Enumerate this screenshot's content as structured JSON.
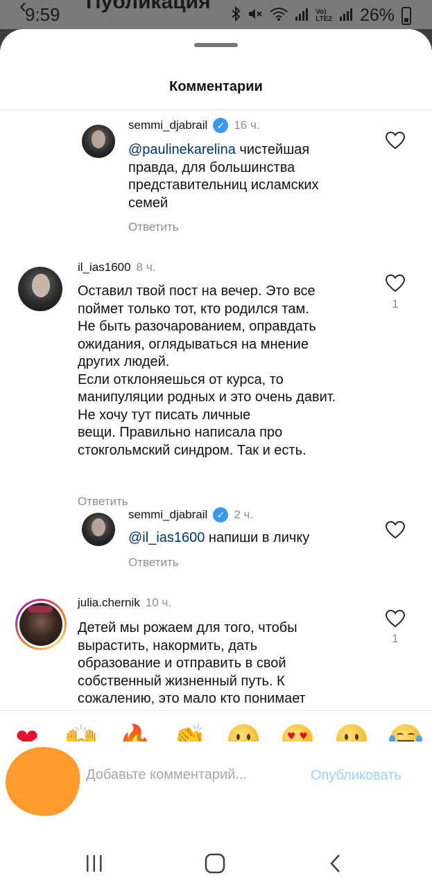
{
  "status_bar": {
    "time": "9:59",
    "title": "Публикация",
    "battery": "26%",
    "icons": [
      "bluetooth-icon",
      "mute-icon",
      "wifi-icon",
      "signal-icon",
      "volte-icon",
      "signal-icon",
      "battery-icon"
    ],
    "volte_label": "Vo)\nLTE2"
  },
  "sheet": {
    "title": "Комментарии"
  },
  "comments": [
    {
      "username": "semmi_djabrail",
      "verified": true,
      "time": "16 ч.",
      "mention": "@paulinekarelina",
      "text": " чистейшая\nправда, для большинства\nпредставительниц  исламских\nсемей",
      "reply": "Ответить",
      "likes": ""
    },
    {
      "username": "il_ias1600",
      "verified": false,
      "time": "8 ч.",
      "text": "Оставил твой пост на вечер. Это все\nпоймет только тот, кто родился там.\nНе быть разочарованием, оправдать\nожидания, оглядываться на мнение\nдругих людей.\nЕсли отклоняешься от курса, то\nманипуляции родных и это очень давит.\nНе хочу тут писать личные\nвещи. Правильно написала про\nстокгольмский синдром. Так и есть.",
      "reply": "Ответить",
      "likes": "1"
    },
    {
      "username": "semmi_djabrail",
      "verified": true,
      "time": "2 ч.",
      "mention": "@il_ias1600",
      "text": " напиши в личку",
      "reply": "Ответить",
      "likes": ""
    },
    {
      "username": "julia.chernik",
      "verified": false,
      "time": "10 ч.",
      "text": "Детей мы рожаем для того, чтобы\nвырастить, накормить, дать\nобразование и отправить в свой\nсобственный жизненный путь. К\nсожалению, это мало кто понимает",
      "reply": "",
      "likes": "1"
    }
  ],
  "emoji_bar": {
    "emojis": [
      {
        "name": "heart",
        "glyph": "❤"
      },
      {
        "name": "raised-hands",
        "glyph": "🙌"
      },
      {
        "name": "fire",
        "glyph": "🔥"
      },
      {
        "name": "clapping-hands",
        "glyph": "👏"
      },
      {
        "name": "crying-face",
        "glyph": ""
      },
      {
        "name": "heart-eyes-face",
        "glyph": ""
      },
      {
        "name": "surprised-face",
        "glyph": ""
      },
      {
        "name": "laughing-tears-face",
        "glyph": ""
      }
    ]
  },
  "composer": {
    "placeholder": "Добавьте комментарий...",
    "publish_label": "Опубликовать"
  },
  "colors": {
    "mention": "#00376b",
    "muted": "#8e8e8e",
    "publish_disabled": "#9fd0f8",
    "verified": "#3897f0"
  }
}
